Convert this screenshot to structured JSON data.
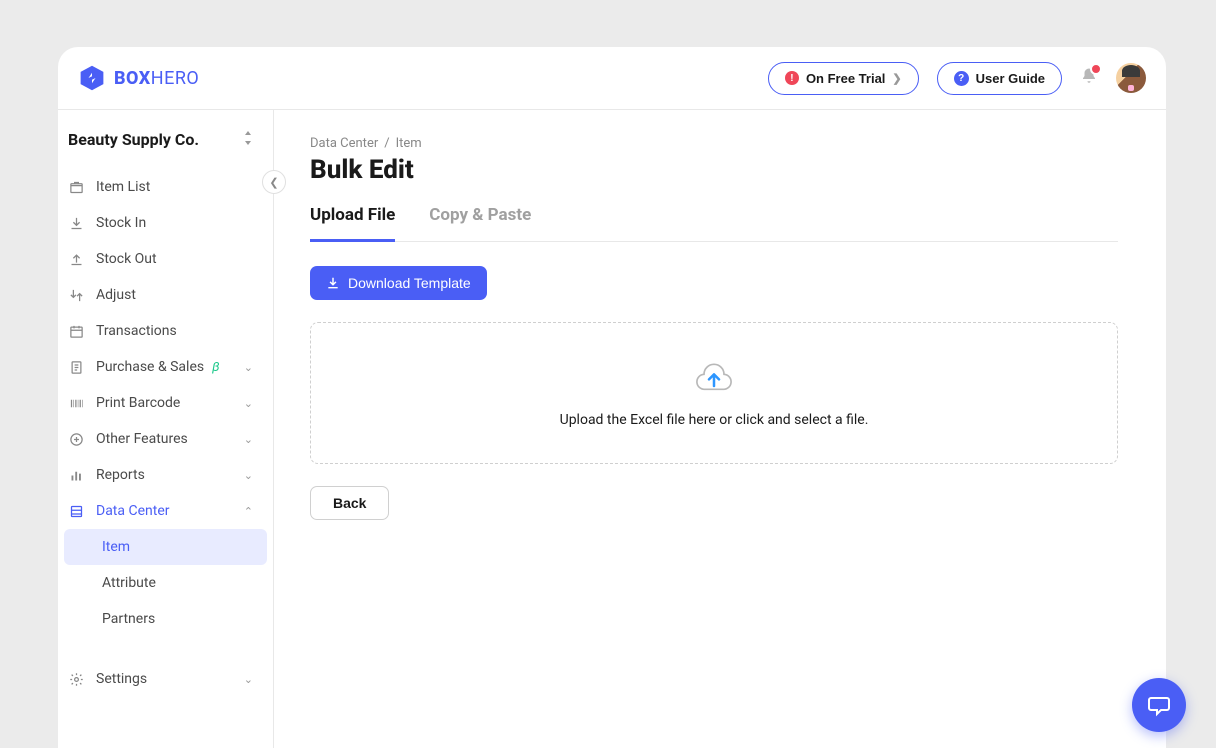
{
  "logo": {
    "bold": "BOX",
    "rest": "HERO"
  },
  "topbar": {
    "trial_label": "On Free Trial",
    "guide_label": "User Guide"
  },
  "team": {
    "name": "Beauty Supply Co."
  },
  "nav": {
    "item_list": "Item List",
    "stock_in": "Stock In",
    "stock_out": "Stock Out",
    "adjust": "Adjust",
    "transactions": "Transactions",
    "purchase_sales": "Purchase & Sales",
    "print_barcode": "Print Barcode",
    "other_features": "Other Features",
    "reports": "Reports",
    "data_center": "Data Center",
    "settings": "Settings"
  },
  "subnav": {
    "item": "Item",
    "attribute": "Attribute",
    "partners": "Partners"
  },
  "breadcrumb": {
    "parent": "Data Center",
    "sep": "/",
    "current": "Item"
  },
  "page": {
    "title": "Bulk Edit"
  },
  "tabs": {
    "upload": "Upload File",
    "copy": "Copy & Paste"
  },
  "buttons": {
    "download_template": "Download Template",
    "back": "Back"
  },
  "dropzone": {
    "text": "Upload the Excel file here or click and select a file."
  }
}
